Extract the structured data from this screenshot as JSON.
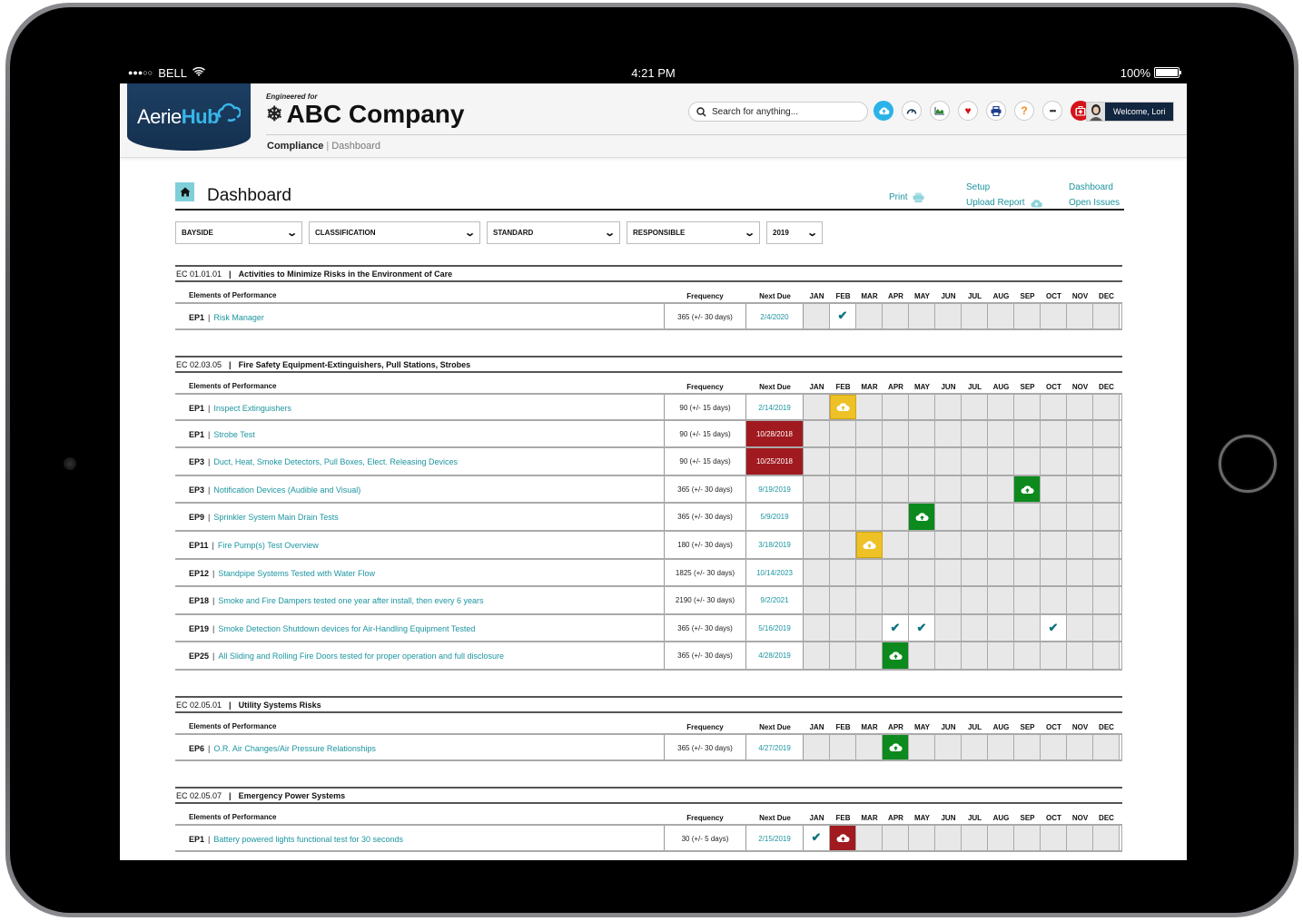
{
  "device": {
    "status": {
      "carrier": "BELL",
      "signal": "●●●○○",
      "time": "4:21 PM",
      "battery": "100%"
    }
  },
  "header": {
    "logo": {
      "part1": "Aerie",
      "part2": "Hub"
    },
    "engineered_for": "Engineered for",
    "company": "ABC Company",
    "breadcrumb": {
      "section": "Compliance",
      "separator": "|",
      "current": "Dashboard"
    },
    "search": {
      "placeholder": "Search for anything..."
    },
    "icons": [
      "upload-icon",
      "dashboard-icon",
      "chart-icon",
      "heart-icon",
      "print-icon",
      "help-icon",
      "more-icon",
      "first-aid-icon"
    ],
    "welcome": "Welcome, Lori"
  },
  "dashboard": {
    "title": "Dashboard",
    "links": {
      "print": "Print",
      "setup": "Setup",
      "upload_report": "Upload Report",
      "dashboard": "Dashboard",
      "open_issues": "Open Issues"
    },
    "filters": [
      {
        "label": "BAYSIDE"
      },
      {
        "label": "CLASSIFICATION"
      },
      {
        "label": "STANDARD"
      },
      {
        "label": "RESPONSIBLE"
      },
      {
        "label": "2019"
      }
    ]
  },
  "table_labels": {
    "elements": "Elements of Performance",
    "frequency": "Frequency",
    "next_due": "Next Due",
    "months": [
      "JAN",
      "FEB",
      "MAR",
      "APR",
      "MAY",
      "JUN",
      "JUL",
      "AUG",
      "SEP",
      "OCT",
      "NOV",
      "DEC"
    ]
  },
  "status_colors": {
    "due_soon": "#eec127",
    "uploaded": "#0c8a1d",
    "overdue": "#a01a1f",
    "complete_check": "#0e7380",
    "link": "#1c95a0"
  },
  "sections": [
    {
      "code": "EC 01.01.01",
      "title": "Activities to Minimize Risks in the Environment of Care",
      "rows": [
        {
          "ep": "EP1",
          "name": "Risk Manager",
          "frequency": "365 (+/- 30 days)",
          "next_due": "2/4/2020",
          "overdue": false,
          "months": {
            "FEB": "check"
          }
        }
      ]
    },
    {
      "code": "EC 02.03.05",
      "title": "Fire Safety Equipment-Extinguishers, Pull Stations, Strobes",
      "rows": [
        {
          "ep": "EP1",
          "name": "Inspect Extinguishers",
          "frequency": "90 (+/- 15 days)",
          "next_due": "2/14/2019",
          "overdue": false,
          "months": {
            "FEB": "yellow"
          }
        },
        {
          "ep": "EP1",
          "name": "Strobe Test",
          "frequency": "90 (+/- 15 days)",
          "next_due": "10/28/2018",
          "overdue": true,
          "months": {}
        },
        {
          "ep": "EP3",
          "name": "Duct, Heat, Smoke Detectors, Pull Boxes, Elect. Releasing Devices",
          "frequency": "90 (+/- 15 days)",
          "next_due": "10/25/2018",
          "overdue": true,
          "months": {}
        },
        {
          "ep": "EP3",
          "name": "Notification Devices (Audible and Visual)",
          "frequency": "365 (+/- 30 days)",
          "next_due": "9/19/2019",
          "overdue": false,
          "months": {
            "SEP": "green"
          }
        },
        {
          "ep": "EP9",
          "name": "Sprinkler System Main Drain Tests",
          "frequency": "365 (+/- 30 days)",
          "next_due": "5/9/2019",
          "overdue": false,
          "months": {
            "MAY": "green"
          }
        },
        {
          "ep": "EP11",
          "name": "Fire Pump(s) Test Overview",
          "frequency": "180 (+/- 30 days)",
          "next_due": "3/18/2019",
          "overdue": false,
          "months": {
            "MAR": "yellow"
          }
        },
        {
          "ep": "EP12",
          "name": "Standpipe Systems Tested with Water Flow",
          "frequency": "1825 (+/- 30 days)",
          "next_due": "10/14/2023",
          "overdue": false,
          "months": {}
        },
        {
          "ep": "EP18",
          "name": "Smoke and Fire Dampers tested one year after install, then every 6 years",
          "frequency": "2190 (+/- 30 days)",
          "next_due": "9/2/2021",
          "overdue": false,
          "months": {}
        },
        {
          "ep": "EP19",
          "name": "Smoke Detection Shutdown devices for Air-Handling Equipment Tested",
          "frequency": "365 (+/- 30 days)",
          "next_due": "5/16/2019",
          "overdue": false,
          "months": {
            "APR": "check",
            "MAY": "check",
            "OCT": "check"
          }
        },
        {
          "ep": "EP25",
          "name": "All Sliding and Rolling Fire Doors tested for proper operation and full disclosure",
          "frequency": "365 (+/- 30 days)",
          "next_due": "4/28/2019",
          "overdue": false,
          "months": {
            "APR": "green"
          }
        }
      ]
    },
    {
      "code": "EC 02.05.01",
      "title": "Utility Systems Risks",
      "rows": [
        {
          "ep": "EP6",
          "name": "O.R. Air Changes/Air Pressure Relationships",
          "frequency": "365 (+/- 30 days)",
          "next_due": "4/27/2019",
          "overdue": false,
          "months": {
            "APR": "green"
          }
        }
      ]
    },
    {
      "code": "EC 02.05.07",
      "title": "Emergency Power Systems",
      "rows": [
        {
          "ep": "EP1",
          "name": "Battery powered lights functional test for 30 seconds",
          "frequency": "30 (+/- 5 days)",
          "next_due": "2/15/2019",
          "overdue": false,
          "months": {
            "JAN": "check",
            "FEB": "red"
          }
        }
      ]
    }
  ]
}
